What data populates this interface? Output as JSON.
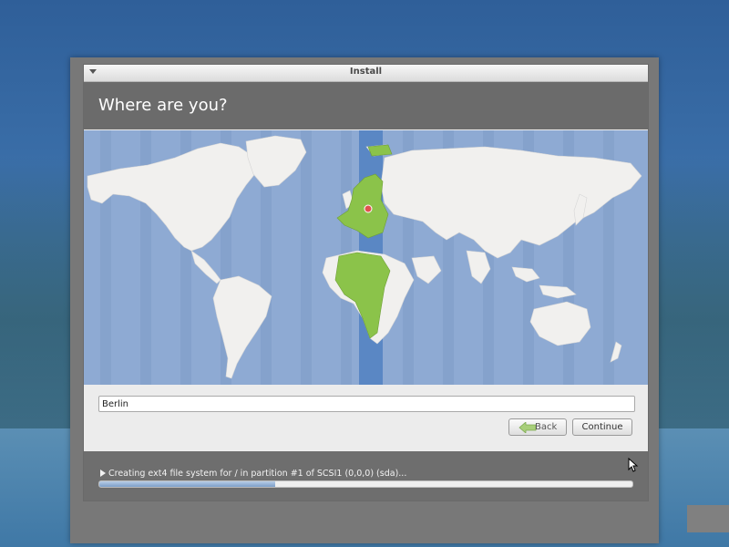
{
  "window": {
    "title": "Install"
  },
  "header": {
    "heading": "Where are you?"
  },
  "location": {
    "city_value": "Berlin"
  },
  "buttons": {
    "back_label": "Back",
    "continue_label": "Continue"
  },
  "progress": {
    "status_text": "Creating ext4 file system for / in partition #1 of SCSI1 (0,0,0) (sda)...",
    "fraction": 0.33
  },
  "colors": {
    "map_ocean": "#8eaad3",
    "land": "#f1f0ee",
    "timezone_band": "#5a87c4",
    "selected_zone": "#8bc34a",
    "header_bg": "#6b6b6b",
    "marker": "#e0524e"
  },
  "icons": {
    "titlebar_menu": "triangle-down-icon",
    "back_arrow": "arrow-left-icon",
    "status": "triangle-right-icon"
  }
}
